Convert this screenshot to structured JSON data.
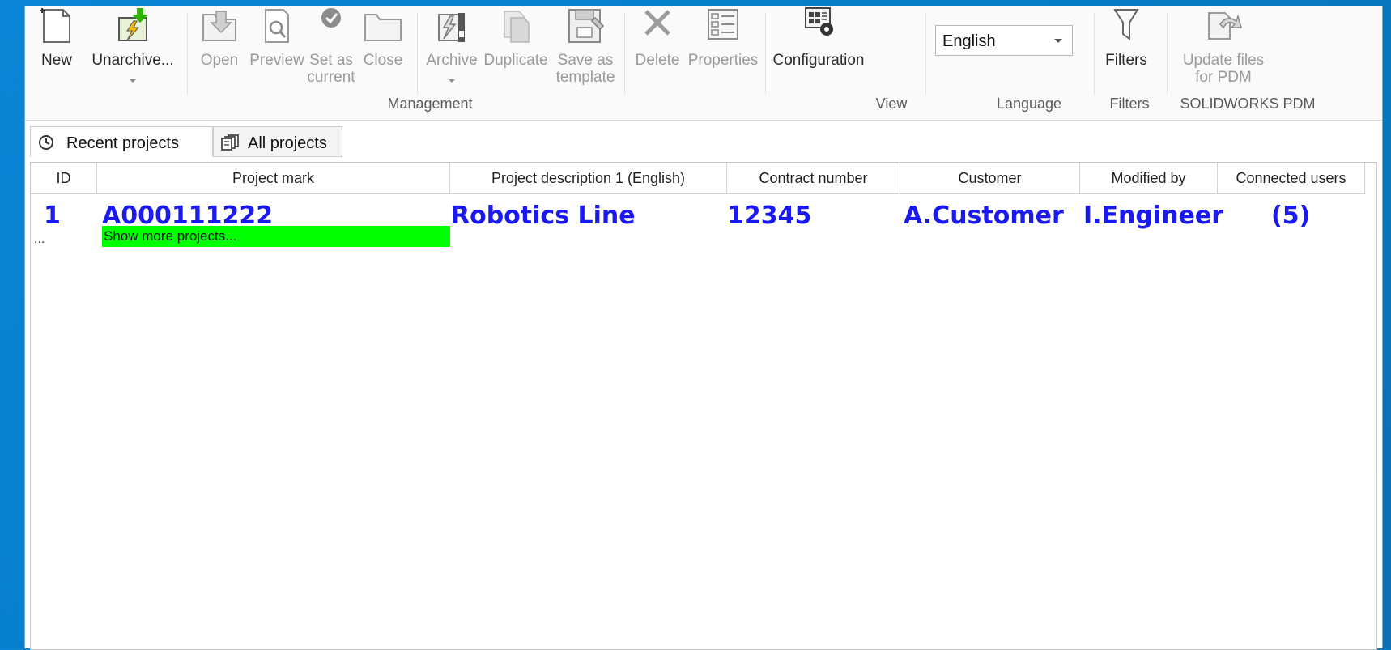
{
  "toolbar": {
    "new": "New",
    "unarchive": "Unarchive...",
    "open": "Open",
    "preview": "Preview",
    "set_as_current": "Set as\ncurrent",
    "close": "Close",
    "archive": "Archive",
    "duplicate": "Duplicate",
    "save_as_template": "Save as\ntemplate",
    "delete": "Delete",
    "properties": "Properties",
    "configuration": "Configuration",
    "filters": "Filters",
    "update_files_for_pdm": "Update files\nfor PDM"
  },
  "groups": {
    "management": "Management",
    "view": "View",
    "language": "Language",
    "filters": "Filters",
    "solidworks_pdm": "SOLIDWORKS PDM"
  },
  "language": {
    "selected": "English"
  },
  "tabs": [
    {
      "label": "Recent projects",
      "active": true
    },
    {
      "label": "All projects",
      "active": false
    }
  ],
  "table": {
    "columns": [
      "ID",
      "Project mark",
      "Project description 1 (English)",
      "Contract number",
      "Customer",
      "Modified by",
      "Connected users"
    ],
    "rows": [
      {
        "id": "1",
        "mark": "A000111222",
        "description": "Robotics Line",
        "contract": "12345",
        "customer": "A.Customer",
        "modified_by": "I.Engineer",
        "connected_users": "(5)"
      }
    ],
    "more_marker": "...",
    "show_more": "Show more projects..."
  },
  "colors": {
    "accent_text": "#1a1af0",
    "show_more_bg": "#00ff00",
    "desktop_blue": "#0a86d6"
  }
}
